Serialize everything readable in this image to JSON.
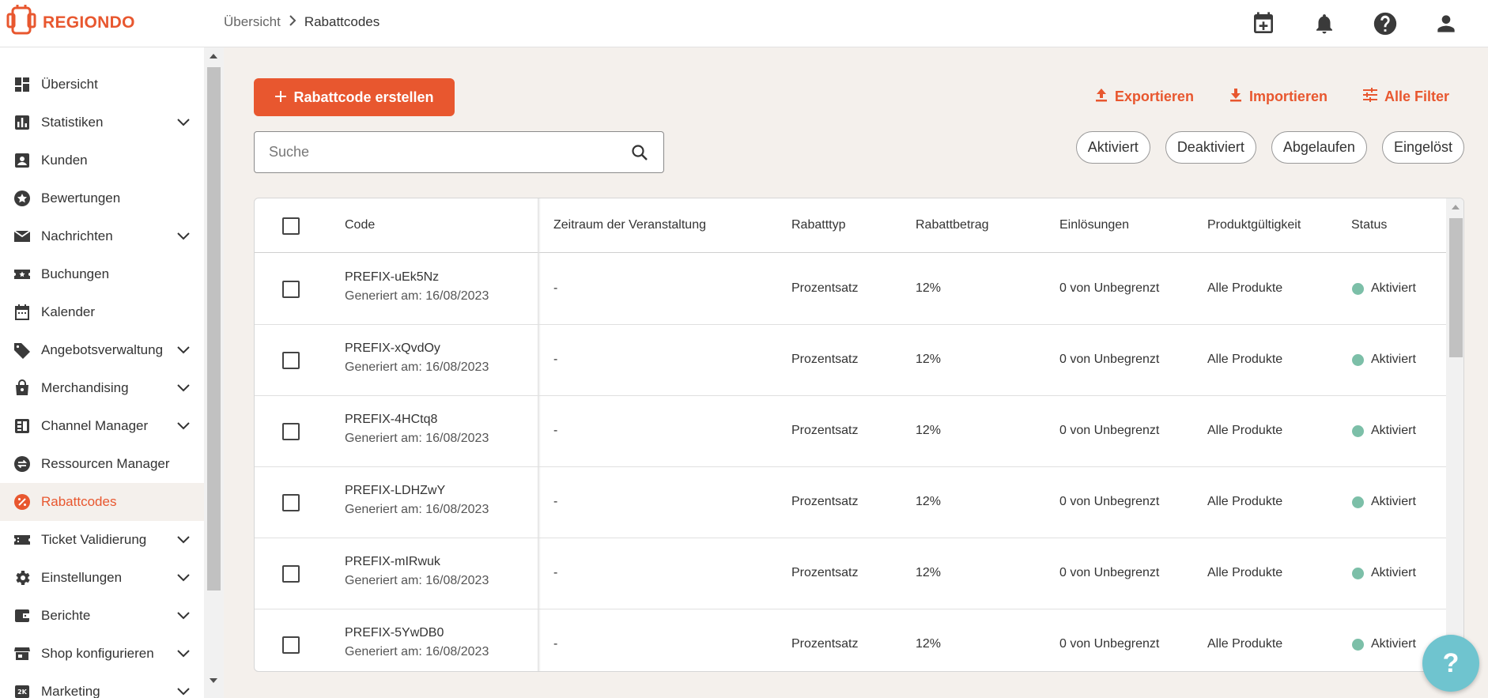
{
  "app": {
    "brand": "REGIONDO",
    "brand_color": "#e8572f"
  },
  "breadcrumb": {
    "parent": "Übersicht",
    "separator": ">",
    "current": "Rabattcodes"
  },
  "header_icons": [
    "calendar-add-icon",
    "bell-icon",
    "help-circle-icon",
    "account-icon"
  ],
  "sidebar": {
    "items": [
      {
        "label": "Übersicht",
        "icon": "dashboard-icon",
        "expandable": false
      },
      {
        "label": "Statistiken",
        "icon": "bar-chart-icon",
        "expandable": true
      },
      {
        "label": "Kunden",
        "icon": "person-card-icon",
        "expandable": false
      },
      {
        "label": "Bewertungen",
        "icon": "star-circle-icon",
        "expandable": false
      },
      {
        "label": "Nachrichten",
        "icon": "mail-icon",
        "expandable": true
      },
      {
        "label": "Buchungen",
        "icon": "ticket-star-icon",
        "expandable": false
      },
      {
        "label": "Kalender",
        "icon": "calendar-icon",
        "expandable": false
      },
      {
        "label": "Angebotsverwaltung",
        "icon": "tag-icon",
        "expandable": true
      },
      {
        "label": "Merchandising",
        "icon": "shopping-bag-icon",
        "expandable": true
      },
      {
        "label": "Channel Manager",
        "icon": "channel-icon",
        "expandable": true
      },
      {
        "label": "Ressourcen Manager",
        "icon": "swap-circle-icon",
        "expandable": false
      },
      {
        "label": "Rabattcodes",
        "icon": "percent-circle-icon",
        "expandable": false,
        "active": true
      },
      {
        "label": "Ticket Validierung",
        "icon": "ticket-validate-icon",
        "expandable": true
      },
      {
        "label": "Einstellungen",
        "icon": "gear-icon",
        "expandable": true
      },
      {
        "label": "Berichte",
        "icon": "wallet-icon",
        "expandable": true
      },
      {
        "label": "Shop konfigurieren",
        "icon": "storefront-icon",
        "expandable": true
      },
      {
        "label": "Marketing",
        "icon": "marketing-icon",
        "expandable": true
      }
    ]
  },
  "toolbar": {
    "create_label": "Rabattcode erstellen",
    "export_label": "Exportieren",
    "import_label": "Importieren",
    "filter_label": "Alle Filter"
  },
  "search": {
    "placeholder": "Suche",
    "value": ""
  },
  "filters": [
    "Aktiviert",
    "Deaktiviert",
    "Abgelaufen",
    "Eingelöst"
  ],
  "table": {
    "columns": [
      "Code",
      "Zeitraum der Veranstaltung",
      "Rabatttyp",
      "Rabattbetrag",
      "Einlösungen",
      "Produktgültigkeit",
      "Status"
    ],
    "rows": [
      {
        "code": "PREFIX-uEk5Nz",
        "generated": "Generiert am: 16/08/2023",
        "period": "-",
        "type": "Prozentsatz",
        "amount": "12%",
        "redemptions": "0 von Unbegrenzt",
        "validity": "Alle Produkte",
        "status": "Aktiviert"
      },
      {
        "code": "PREFIX-xQvdOy",
        "generated": "Generiert am: 16/08/2023",
        "period": "-",
        "type": "Prozentsatz",
        "amount": "12%",
        "redemptions": "0 von Unbegrenzt",
        "validity": "Alle Produkte",
        "status": "Aktiviert"
      },
      {
        "code": "PREFIX-4HCtq8",
        "generated": "Generiert am: 16/08/2023",
        "period": "-",
        "type": "Prozentsatz",
        "amount": "12%",
        "redemptions": "0 von Unbegrenzt",
        "validity": "Alle Produkte",
        "status": "Aktiviert"
      },
      {
        "code": "PREFIX-LDHZwY",
        "generated": "Generiert am: 16/08/2023",
        "period": "-",
        "type": "Prozentsatz",
        "amount": "12%",
        "redemptions": "0 von Unbegrenzt",
        "validity": "Alle Produkte",
        "status": "Aktiviert"
      },
      {
        "code": "PREFIX-mIRwuk",
        "generated": "Generiert am: 16/08/2023",
        "period": "-",
        "type": "Prozentsatz",
        "amount": "12%",
        "redemptions": "0 von Unbegrenzt",
        "validity": "Alle Produkte",
        "status": "Aktiviert"
      },
      {
        "code": "PREFIX-5YwDB0",
        "generated": "Generiert am: 16/08/2023",
        "period": "-",
        "type": "Prozentsatz",
        "amount": "12%",
        "redemptions": "0 von Unbegrenzt",
        "validity": "Alle Produkte",
        "status": "Aktiviert"
      }
    ],
    "status_color": "#7cbfa8"
  },
  "help_fab": {
    "label": "?",
    "color": "#6fc4cf"
  }
}
